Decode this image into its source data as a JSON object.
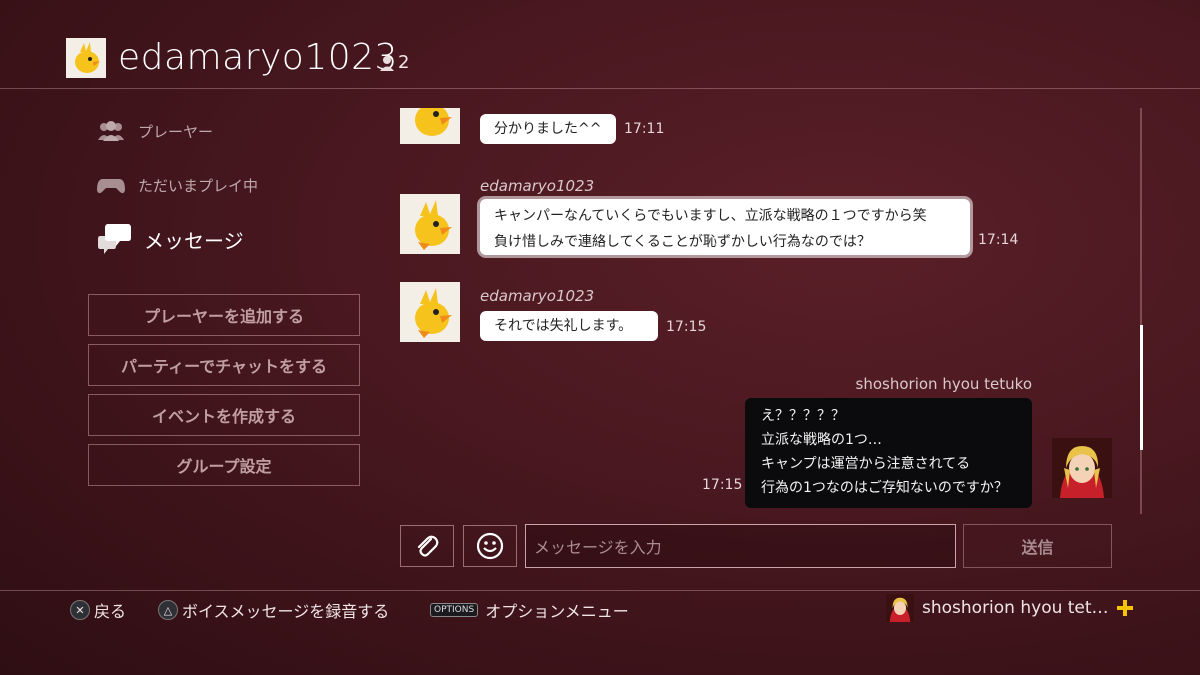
{
  "header": {
    "username": "edamaryo1023",
    "member_count": "2"
  },
  "sidebar": {
    "nav": [
      {
        "label": "プレーヤー",
        "icon": "players-icon"
      },
      {
        "label": "ただいまプレイ中",
        "icon": "controller-icon"
      },
      {
        "label": "メッセージ",
        "icon": "messages-icon",
        "active": true
      }
    ],
    "buttons": [
      {
        "label": "プレーヤーを追加する"
      },
      {
        "label": "パーティーでチャットをする"
      },
      {
        "label": "イベントを作成する"
      },
      {
        "label": "グループ設定"
      }
    ]
  },
  "messages": [
    {
      "sender": "",
      "text": "分かりました^^",
      "time": "17:11"
    },
    {
      "sender": "edamaryo1023",
      "lines": [
        "キャンパーなんていくらでもいますし、立派な戦略の１つですから笑",
        "負け惜しみで連絡してくることが恥ずかしい行為なのでは？"
      ],
      "time": "17:14"
    },
    {
      "sender": "edamaryo1023",
      "text": "それでは失礼します。",
      "time": "17:15"
    },
    {
      "sender": "shoshorion hyou tetuko",
      "lines": [
        "え？？？？？",
        "立派な戦略の1つ…",
        "キャンプは運営から注意されてる",
        "行為の1つなのはご存知ないのですか？"
      ],
      "time": "17:15"
    }
  ],
  "composer": {
    "placeholder": "メッセージを入力",
    "send_label": "送信"
  },
  "footer": {
    "back": "戻る",
    "voice": "ボイスメッセージを録音する",
    "options_key": "OPTIONS",
    "options": "オプションメニュー",
    "user": "shoshorion hyou tet…"
  },
  "colors": {
    "background": "#4a1820",
    "ps_plus": "#f5c400"
  }
}
